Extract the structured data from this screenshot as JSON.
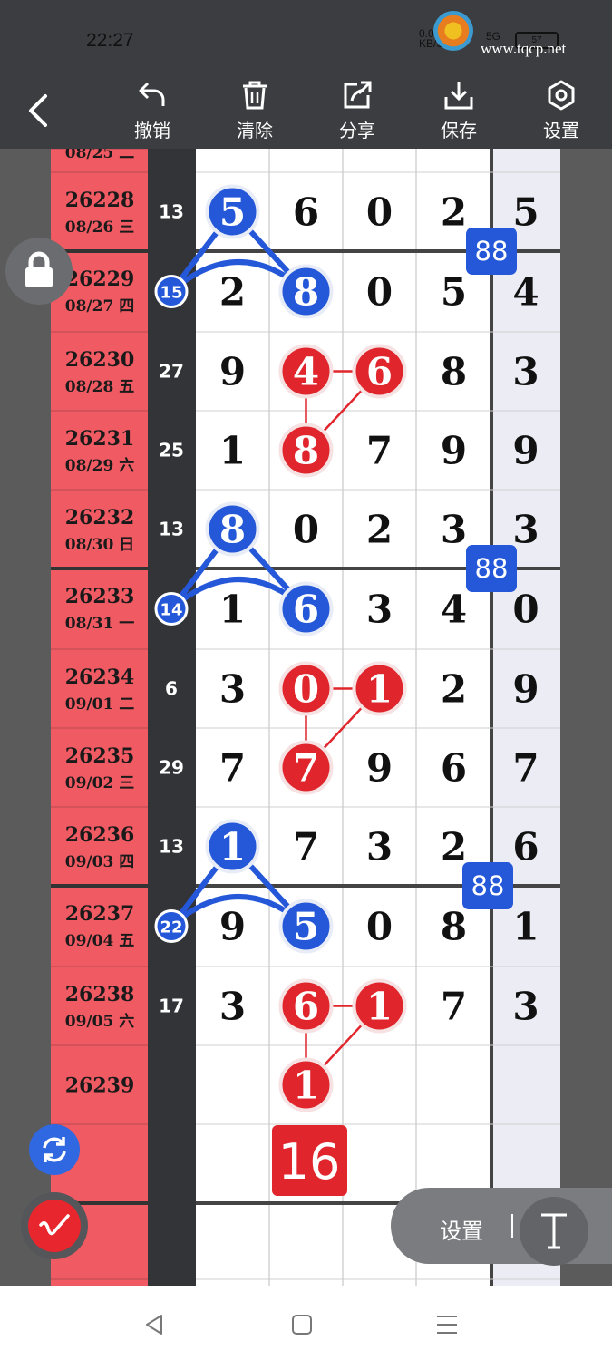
{
  "status_bar": {
    "time": "22:27",
    "net_speed": "0.00",
    "net_unit": "KB/S",
    "signal": "5G",
    "battery": "57"
  },
  "watermark": {
    "site": "www.tqcp.net"
  },
  "toolbar": {
    "undo_label": "撤销",
    "clear_label": "清除",
    "share_label": "分享",
    "save_label": "保存",
    "settings_label": "设置"
  },
  "draw_panel": {
    "settings_label": "设置"
  },
  "colors": {
    "red_cell": "#f05a63",
    "dark_column": "#333437",
    "blue_mark": "#2558d9",
    "red_mark": "#e0262c",
    "last_column": "#ececf4"
  },
  "icons": [
    "back-arrow-icon",
    "undo-icon",
    "trash-icon",
    "share-icon",
    "download-icon",
    "settings-hexagon-icon",
    "lock-icon",
    "refresh-icon",
    "pen-icon",
    "text-tool-icon"
  ],
  "partial_top_row": {
    "date": "08/25 二"
  },
  "rows": [
    {
      "issue": "26228",
      "date": "08/26 三",
      "sum": "13",
      "digits": [
        "5",
        "6",
        "0",
        "2",
        "5"
      ]
    },
    {
      "issue": "26229",
      "date": "08/27 四",
      "sum": "15",
      "digits": [
        "2",
        "8",
        "0",
        "5",
        "4"
      ]
    },
    {
      "issue": "26230",
      "date": "08/28 五",
      "sum": "27",
      "digits": [
        "9",
        "4",
        "6",
        "8",
        "3"
      ]
    },
    {
      "issue": "26231",
      "date": "08/29 六",
      "sum": "25",
      "digits": [
        "1",
        "8",
        "7",
        "9",
        "9"
      ]
    },
    {
      "issue": "26232",
      "date": "08/30 日",
      "sum": "13",
      "digits": [
        "8",
        "0",
        "2",
        "3",
        "3"
      ]
    },
    {
      "issue": "26233",
      "date": "08/31 一",
      "sum": "14",
      "digits": [
        "1",
        "6",
        "3",
        "4",
        "0"
      ]
    },
    {
      "issue": "26234",
      "date": "09/01 二",
      "sum": "6",
      "digits": [
        "3",
        "0",
        "1",
        "2",
        "9"
      ]
    },
    {
      "issue": "26235",
      "date": "09/02 三",
      "sum": "29",
      "digits": [
        "7",
        "7",
        "9",
        "6",
        "7"
      ]
    },
    {
      "issue": "26236",
      "date": "09/03 四",
      "sum": "13",
      "digits": [
        "1",
        "7",
        "3",
        "2",
        "6"
      ]
    },
    {
      "issue": "26237",
      "date": "09/04 五",
      "sum": "22",
      "digits": [
        "9",
        "5",
        "0",
        "8",
        "1"
      ]
    },
    {
      "issue": "26238",
      "date": "09/05 六",
      "sum": "17",
      "digits": [
        "3",
        "6",
        "1",
        "7",
        "3"
      ]
    },
    {
      "issue": "26239",
      "date": "",
      "sum": "",
      "digits": [
        "",
        "1",
        "",
        "",
        ""
      ]
    },
    {
      "issue": "",
      "date": "",
      "sum": "",
      "digits": [
        "",
        "",
        "",
        "",
        ""
      ]
    },
    {
      "issue": "",
      "date": "",
      "sum": "",
      "digits": [
        "",
        "",
        "",
        "",
        ""
      ]
    }
  ],
  "blue_circled": [
    [
      0,
      0
    ],
    [
      1,
      1
    ],
    [
      4,
      0
    ],
    [
      5,
      1
    ],
    [
      8,
      0
    ],
    [
      9,
      1
    ]
  ],
  "blue_sum_circled": [
    1,
    5,
    9
  ],
  "red_circled": [
    [
      2,
      1
    ],
    [
      2,
      2
    ],
    [
      3,
      1
    ],
    [
      6,
      1
    ],
    [
      6,
      2
    ],
    [
      7,
      1
    ],
    [
      10,
      1
    ],
    [
      10,
      2
    ],
    [
      11,
      1
    ]
  ],
  "badges": [
    {
      "text": "88",
      "row": 0
    },
    {
      "text": "88",
      "row": 4
    },
    {
      "text": "88",
      "row": 8
    }
  ],
  "prediction": {
    "text": "16"
  }
}
